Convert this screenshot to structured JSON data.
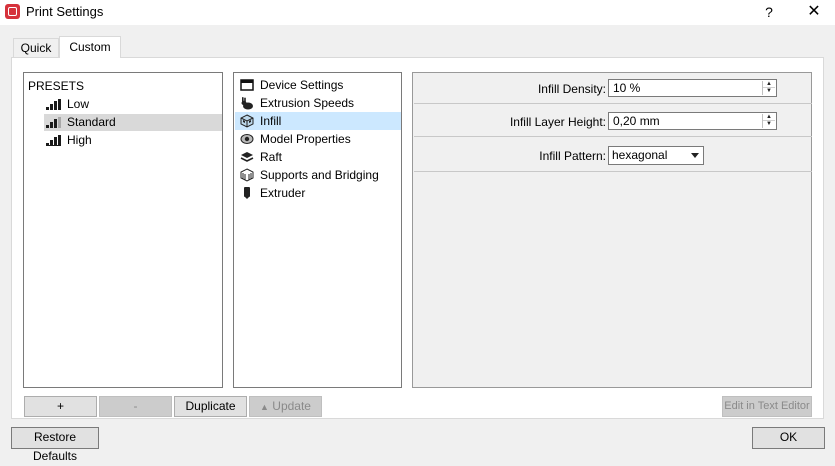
{
  "window": {
    "title": "Print Settings",
    "help": "?",
    "close": "✕"
  },
  "tabs": [
    {
      "label": "Quick",
      "active": false
    },
    {
      "label": "Custom",
      "active": true
    }
  ],
  "presets": {
    "root": "PRESETS",
    "items": [
      {
        "label": "Low",
        "level": 3,
        "selected": false
      },
      {
        "label": "Standard",
        "level": 4,
        "selected": true
      },
      {
        "label": "High",
        "level": 5,
        "selected": false
      }
    ]
  },
  "categories": [
    {
      "label": "Device Settings",
      "icon": "window-icon",
      "selected": false
    },
    {
      "label": "Extrusion Speeds",
      "icon": "rabbit-icon",
      "selected": false
    },
    {
      "label": "Infill",
      "icon": "infill-cube-icon",
      "selected": true
    },
    {
      "label": "Model Properties",
      "icon": "eye-icon",
      "selected": false
    },
    {
      "label": "Raft",
      "icon": "layers-icon",
      "selected": false
    },
    {
      "label": "Supports and Bridging",
      "icon": "support-cube-icon",
      "selected": false
    },
    {
      "label": "Extruder",
      "icon": "extruder-icon",
      "selected": false
    }
  ],
  "settings": {
    "density": {
      "label": "Infill Density:",
      "value": "10 %"
    },
    "layer_height": {
      "label": "Infill Layer Height:",
      "value": "0,20 mm"
    },
    "pattern": {
      "label": "Infill Pattern:",
      "value": "hexagonal"
    }
  },
  "buttons": {
    "add": "+",
    "remove": "-",
    "duplicate": "Duplicate",
    "update": "Update",
    "edit_text": "Edit in Text Editor",
    "restore": "Restore Defaults",
    "ok": "OK"
  },
  "colors": {
    "accent_selected": "#cce8ff",
    "preset_selected": "#d9d9d9",
    "brand": "#d6323c"
  }
}
